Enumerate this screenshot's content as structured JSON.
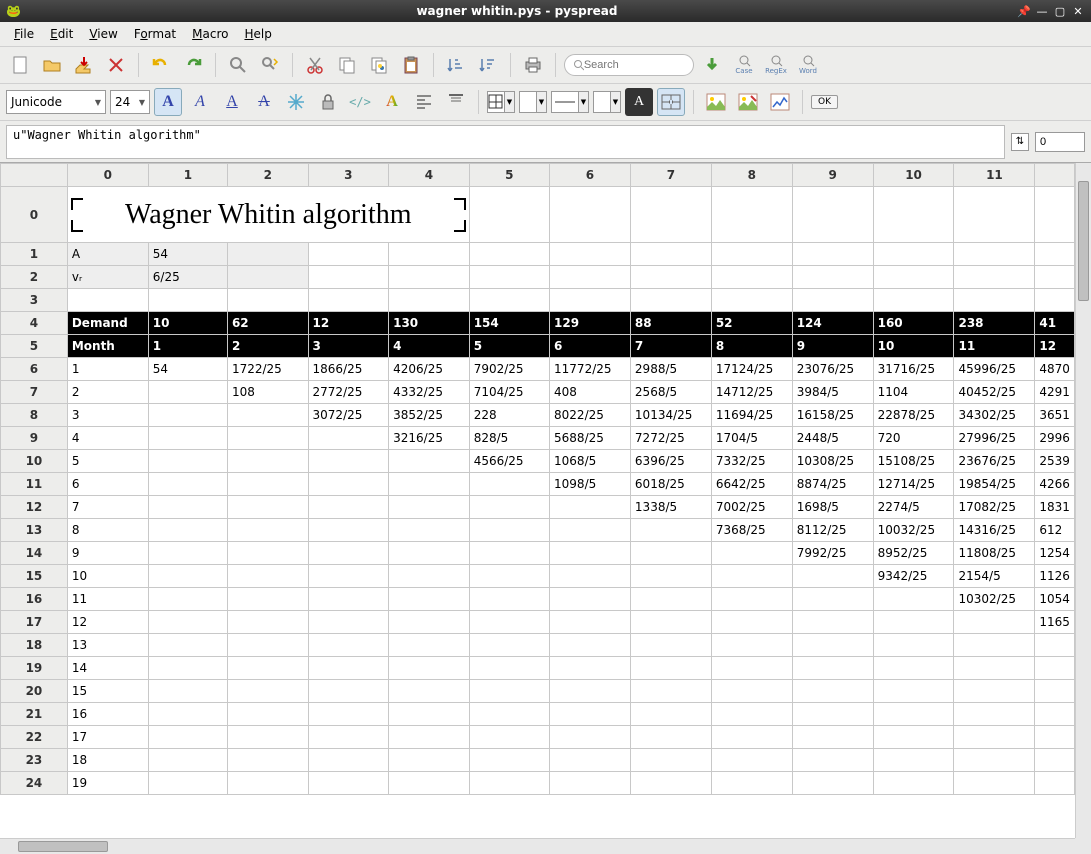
{
  "window": {
    "title": "wagner whitin.pys - pyspread"
  },
  "menubar": [
    "File",
    "Edit",
    "View",
    "Format",
    "Macro",
    "Help"
  ],
  "toolbar1": {
    "search_placeholder": "Search",
    "icons": [
      "new",
      "open",
      "save",
      "export",
      "undo",
      "redo",
      "find",
      "find-replace",
      "cut",
      "copy",
      "paste-python",
      "paste",
      "sort-asc",
      "sort-desc",
      "print",
      "search-go",
      "case",
      "regex",
      "word"
    ]
  },
  "toolbar2": {
    "font_name": "Junicode",
    "font_size": "24",
    "ok_label": "OK"
  },
  "formula": {
    "text": "u\"Wagner Whitin algorithm\"",
    "z_value": "0",
    "z_icon": "⇅"
  },
  "grid": {
    "col_headers": [
      "0",
      "1",
      "2",
      "3",
      "4",
      "5",
      "6",
      "7",
      "8",
      "9",
      "10",
      "11"
    ],
    "row_headers": [
      "0",
      "1",
      "2",
      "3",
      "4",
      "5",
      "6",
      "7",
      "8",
      "9",
      "10",
      "11",
      "12",
      "13",
      "14",
      "15",
      "16",
      "17",
      "18",
      "19",
      "20",
      "21",
      "22",
      "23",
      "24"
    ],
    "title_text": "Wagner Whitin algorithm",
    "rows": [
      null,
      [
        "A",
        "54",
        "",
        "",
        "",
        "",
        "",
        "",
        "",
        "",
        "",
        "",
        ""
      ],
      [
        "vᵣ",
        "6/25",
        "",
        "",
        "",
        "",
        "",
        "",
        "",
        "",
        "",
        "",
        ""
      ],
      [
        "",
        "",
        "",
        "",
        "",
        "",
        "",
        "",
        "",
        "",
        "",
        "",
        ""
      ],
      [
        "Demand",
        "10",
        "62",
        "12",
        "130",
        "154",
        "129",
        "88",
        "52",
        "124",
        "160",
        "238",
        "41"
      ],
      [
        "Month",
        "1",
        "2",
        "3",
        "4",
        "5",
        "6",
        "7",
        "8",
        "9",
        "10",
        "11",
        "12"
      ],
      [
        "1",
        "54",
        "1722/25",
        "1866/25",
        "4206/25",
        "7902/25",
        "11772/25",
        "2988/5",
        "17124/25",
        "23076/25",
        "31716/25",
        "45996/25",
        "4870"
      ],
      [
        "2",
        "",
        "108",
        "2772/25",
        "4332/25",
        "7104/25",
        "408",
        "2568/5",
        "14712/25",
        "3984/5",
        "1104",
        "40452/25",
        "4291"
      ],
      [
        "3",
        "",
        "",
        "3072/25",
        "3852/25",
        "228",
        "8022/25",
        "10134/25",
        "11694/25",
        "16158/25",
        "22878/25",
        "34302/25",
        "3651"
      ],
      [
        "4",
        "",
        "",
        "",
        "3216/25",
        "828/5",
        "5688/25",
        "7272/25",
        "1704/5",
        "2448/5",
        "720",
        "27996/25",
        "2996"
      ],
      [
        "5",
        "",
        "",
        "",
        "",
        "4566/25",
        "1068/5",
        "6396/25",
        "7332/25",
        "10308/25",
        "15108/25",
        "23676/25",
        "2539"
      ],
      [
        "6",
        "",
        "",
        "",
        "",
        "",
        "1098/5",
        "6018/25",
        "6642/25",
        "8874/25",
        "12714/25",
        "19854/25",
        "4266"
      ],
      [
        "7",
        "",
        "",
        "",
        "",
        "",
        "",
        "1338/5",
        "7002/25",
        "1698/5",
        "2274/5",
        "17082/25",
        "1831"
      ],
      [
        "8",
        "",
        "",
        "",
        "",
        "",
        "",
        "",
        "7368/25",
        "8112/25",
        "10032/25",
        "14316/25",
        "612"
      ],
      [
        "9",
        "",
        "",
        "",
        "",
        "",
        "",
        "",
        "",
        "7992/25",
        "8952/25",
        "11808/25",
        "1254"
      ],
      [
        "10",
        "",
        "",
        "",
        "",
        "",
        "",
        "",
        "",
        "",
        "9342/25",
        "2154/5",
        "1126"
      ],
      [
        "11",
        "",
        "",
        "",
        "",
        "",
        "",
        "",
        "",
        "",
        "",
        "10302/25",
        "1054"
      ],
      [
        "12",
        "",
        "",
        "",
        "",
        "",
        "",
        "",
        "",
        "",
        "",
        "",
        "1165"
      ],
      [
        "13",
        "",
        "",
        "",
        "",
        "",
        "",
        "",
        "",
        "",
        "",
        "",
        ""
      ],
      [
        "14",
        "",
        "",
        "",
        "",
        "",
        "",
        "",
        "",
        "",
        "",
        "",
        ""
      ],
      [
        "15",
        "",
        "",
        "",
        "",
        "",
        "",
        "",
        "",
        "",
        "",
        "",
        ""
      ],
      [
        "16",
        "",
        "",
        "",
        "",
        "",
        "",
        "",
        "",
        "",
        "",
        "",
        ""
      ],
      [
        "17",
        "",
        "",
        "",
        "",
        "",
        "",
        "",
        "",
        "",
        "",
        "",
        ""
      ],
      [
        "18",
        "",
        "",
        "",
        "",
        "",
        "",
        "",
        "",
        "",
        "",
        "",
        ""
      ],
      [
        "19",
        "",
        "",
        "",
        "",
        "",
        "",
        "",
        "",
        "",
        "",
        "",
        ""
      ]
    ]
  }
}
